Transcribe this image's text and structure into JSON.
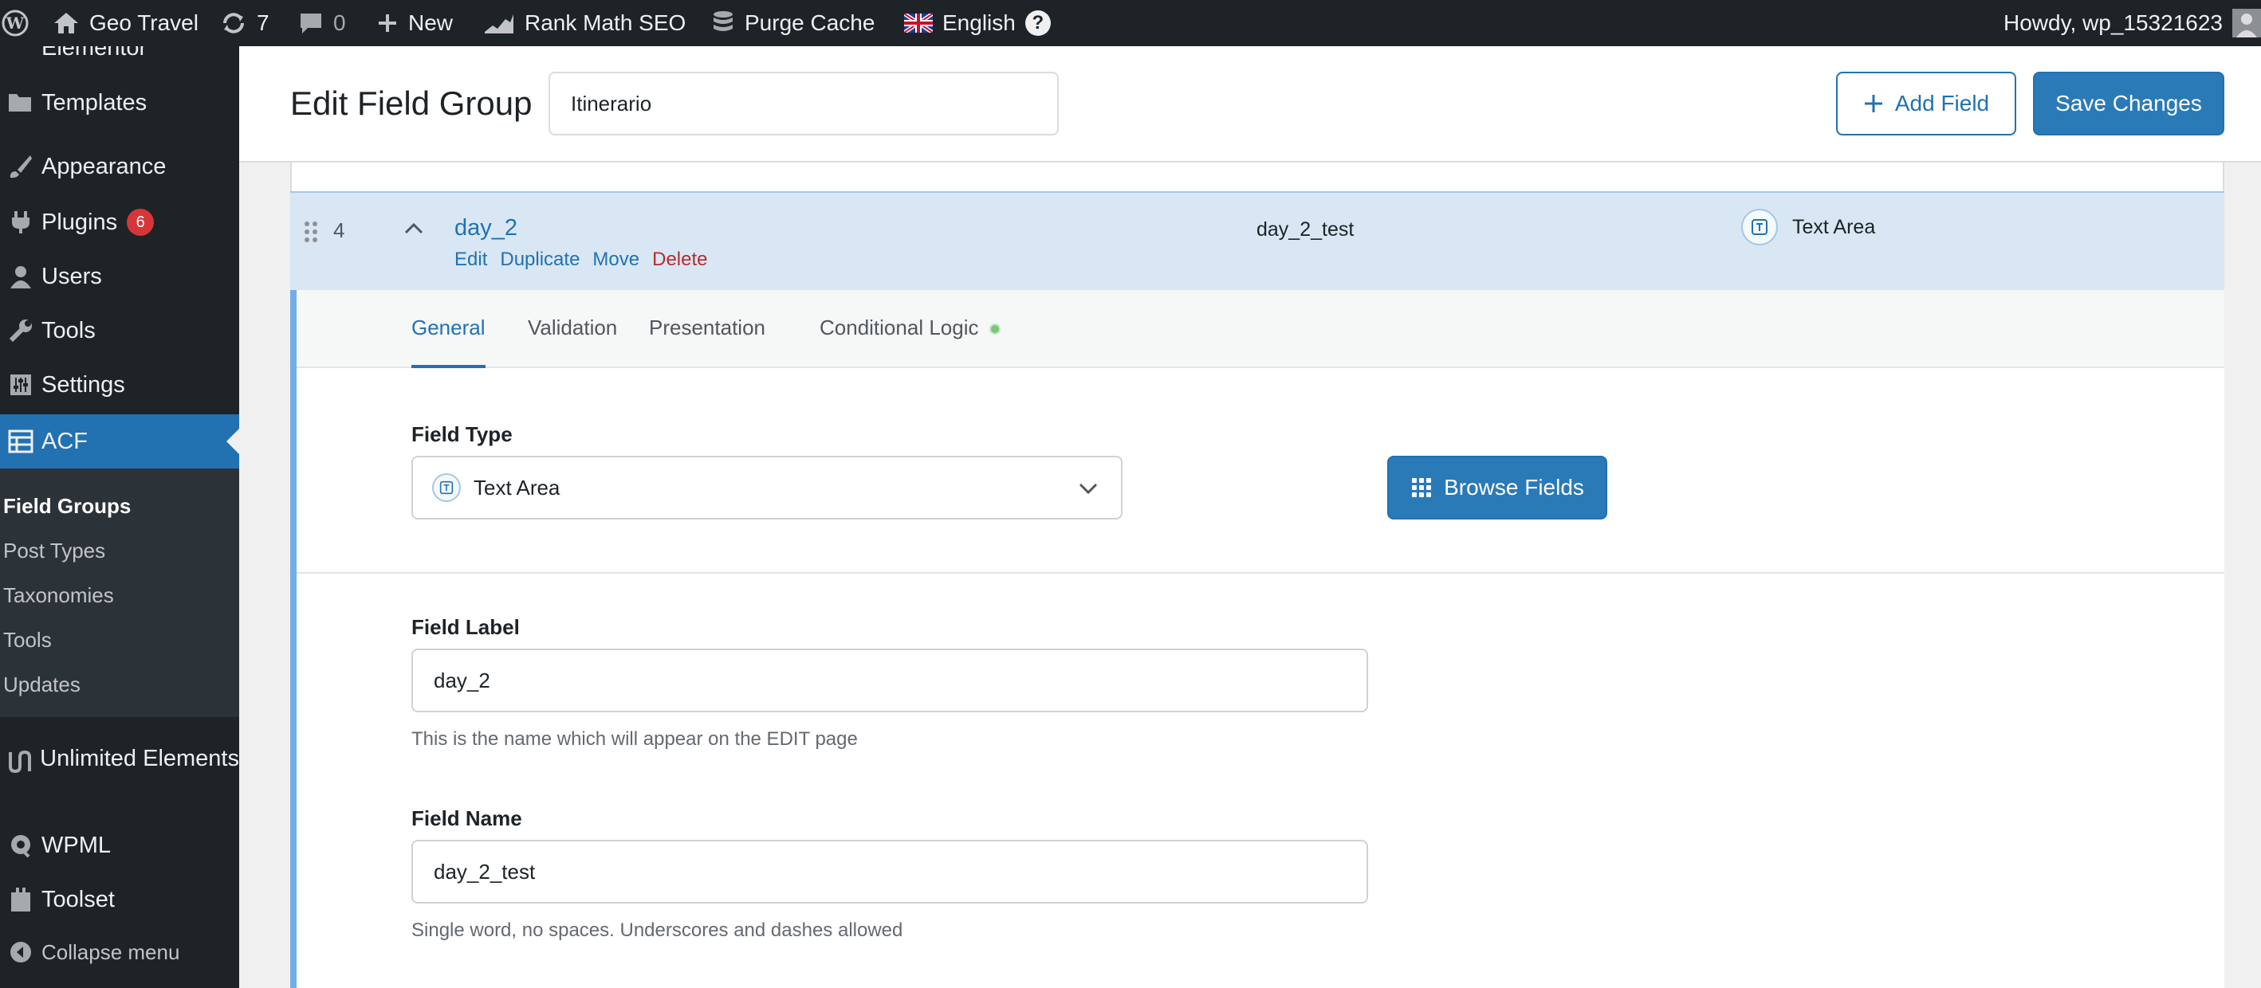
{
  "adminbar": {
    "site_name": "Geo Travel",
    "updates_count": "7",
    "comments_count": "0",
    "new_label": "New",
    "rank_math_label": "Rank Math SEO",
    "purge_cache_label": "Purge Cache",
    "language_label": "English",
    "help_glyph": "?",
    "howdy": "Howdy, wp_15321623"
  },
  "sidebar": {
    "partial_top_label": "Elementor",
    "templates": "Templates",
    "appearance": "Appearance",
    "plugins": "Plugins",
    "plugins_badge": "6",
    "users": "Users",
    "tools": "Tools",
    "settings": "Settings",
    "acf": "ACF",
    "submenu": [
      "Field Groups",
      "Post Types",
      "Taxonomies",
      "Tools",
      "Updates"
    ],
    "unlimited_elements": "Unlimited Elements",
    "wpml": "WPML",
    "toolset": "Toolset",
    "collapse": "Collapse menu"
  },
  "header": {
    "title": "Edit Field Group",
    "group_title_value": "Itinerario",
    "add_field": "Add Field",
    "save_changes": "Save Changes"
  },
  "field": {
    "order": "4",
    "label": "day_2",
    "name": "day_2_test",
    "type": "Text Area",
    "actions": {
      "edit": "Edit",
      "duplicate": "Duplicate",
      "move": "Move",
      "delete": "Delete"
    }
  },
  "tabs": [
    "General",
    "Validation",
    "Presentation",
    "Conditional Logic"
  ],
  "settings": {
    "field_type_label": "Field Type",
    "field_type_value": "Text Area",
    "browse_fields": "Browse Fields",
    "field_label_label": "Field Label",
    "field_label_value": "day_2",
    "field_label_help": "This is the name which will appear on the EDIT page",
    "field_name_label": "Field Name",
    "field_name_value": "day_2_test",
    "field_name_help": "Single word, no spaces. Underscores and dashes allowed"
  },
  "colors": {
    "adminbar_bg": "#1d2327",
    "accent": "#2271b1",
    "active_row": "#d8e7f3",
    "delete": "#b32d2e",
    "badge": "#d63638"
  }
}
